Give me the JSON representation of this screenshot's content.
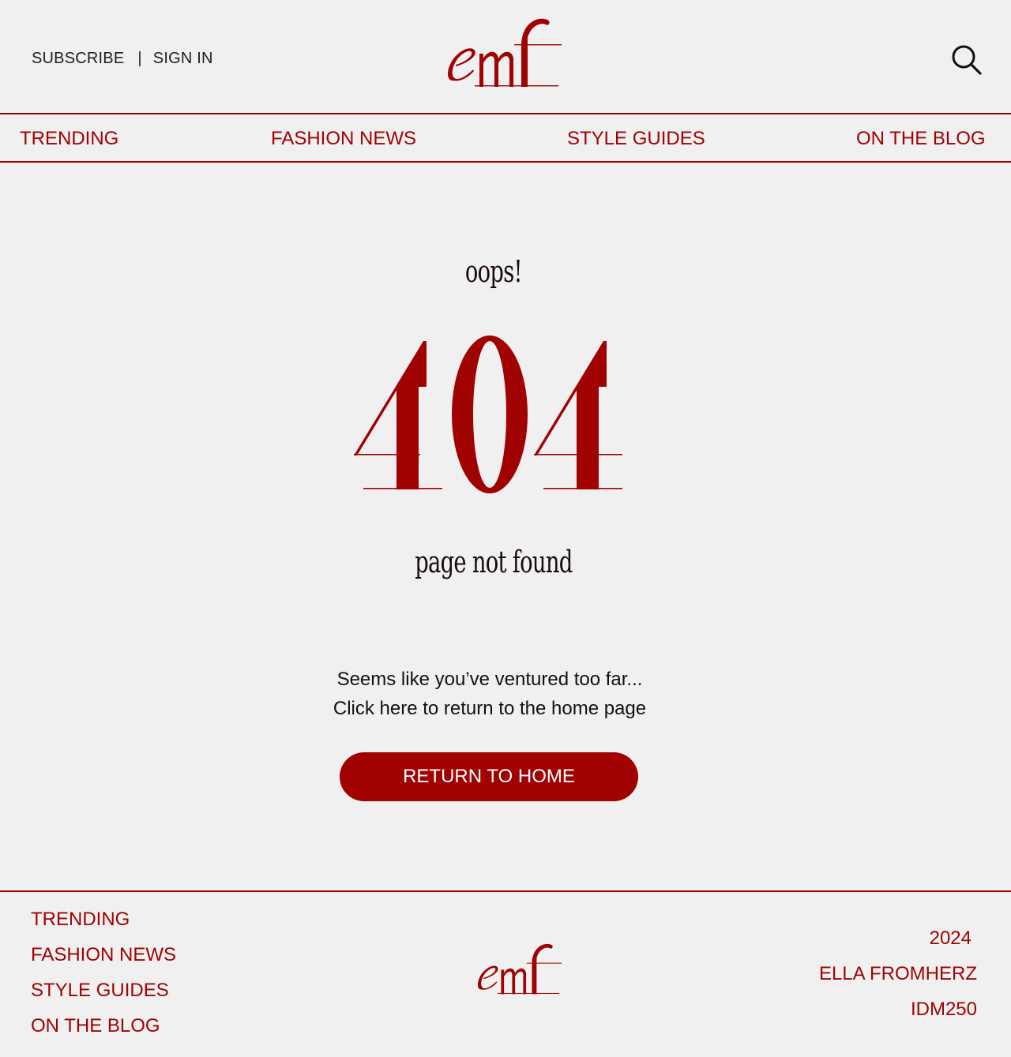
{
  "header": {
    "subscribe_label": "SUBSCRIBE",
    "separator": "|",
    "signin_label": "SIGN IN",
    "logo_text": "emf",
    "search_icon": "search-icon"
  },
  "nav": {
    "items": [
      {
        "label": "TRENDING"
      },
      {
        "label": "FASHION NEWS"
      },
      {
        "label": "STYLE GUIDES"
      },
      {
        "label": "ON THE BLOG"
      }
    ]
  },
  "main": {
    "oops": "oops!",
    "error_code": "404",
    "subtitle": "page not found",
    "message_line1": "Seems like you’ve ventured too far...",
    "message_line2": "Click here to return to the home page",
    "button_label": "RETURN TO HOME"
  },
  "footer": {
    "nav_items": [
      {
        "label": "TRENDING"
      },
      {
        "label": "FASHION NEWS"
      },
      {
        "label": "STYLE GUIDES"
      },
      {
        "label": "ON THE BLOG"
      }
    ],
    "logo_text": "emf",
    "year": "2024",
    "author": "ELLA FROMHERZ",
    "course": "IDM250"
  },
  "colors": {
    "accent": "#a00202",
    "background": "#f0f0f0",
    "text": "#111111"
  }
}
